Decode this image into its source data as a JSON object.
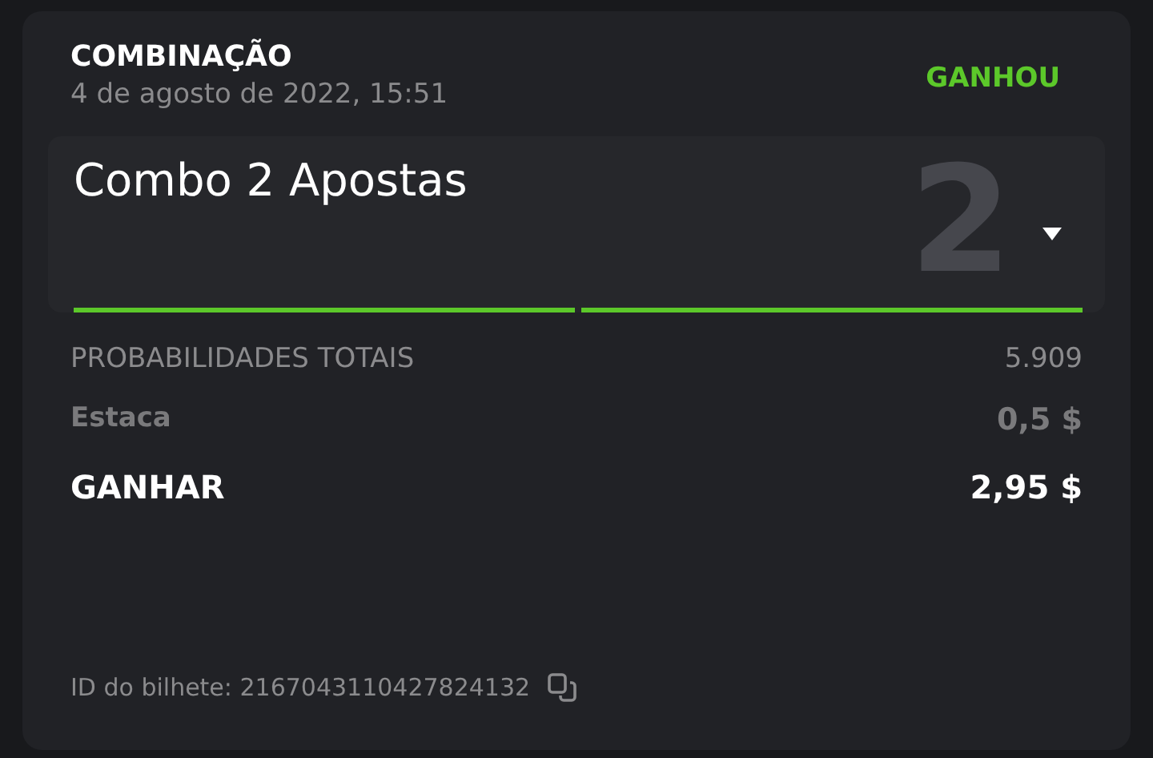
{
  "header": {
    "title": "COMBINAÇÃO",
    "date": "4 de agosto de 2022, 15:51",
    "result": "GANHOU"
  },
  "combo": {
    "title": "Combo 2 Apostas",
    "count": "2",
    "expanded": false,
    "legs": [
      {
        "color": "#5cc82a"
      },
      {
        "color": "#5cc82a"
      }
    ]
  },
  "rows": [
    {
      "kind": "odds",
      "label": "PROBABILIDADES TOTAIS",
      "value": "5.909"
    },
    {
      "kind": "stake",
      "label": "Estaca",
      "value": "0,5 $"
    },
    {
      "kind": "win",
      "label": "GANHAR",
      "value": "2,95 $"
    }
  ],
  "ticket": {
    "label": "ID do bilhete: 2167043110427824132"
  }
}
